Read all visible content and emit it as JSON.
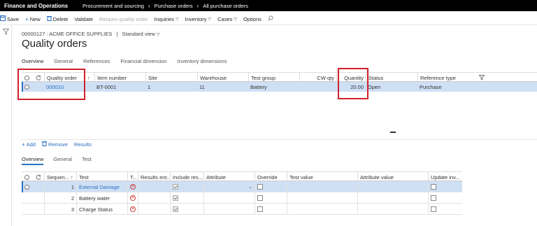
{
  "topbar": {
    "app_title": "Finance and Operations",
    "breadcrumbs": [
      "Procurement and sourcing",
      "Purchase orders",
      "All purchase orders"
    ]
  },
  "actionbar": {
    "save": "Save",
    "new": "New",
    "delete": "Delete",
    "validate": "Validate",
    "reopen": "Reopen quality order",
    "inquiries": "Inquiries",
    "inventory": "Inventory",
    "cases": "Cases",
    "options": "Options"
  },
  "header": {
    "record": "00000127 : ACME OFFICE SUPPLIES",
    "separator": "|",
    "view": "Standard view",
    "title": "Quality orders"
  },
  "tabs_top": [
    "Overview",
    "General",
    "References",
    "Financial dimension",
    "Inventory dimensions"
  ],
  "quality_grid": {
    "columns": {
      "quality_order": "Quality order",
      "item_number": "Item number",
      "site": "Site",
      "warehouse": "Warehouse",
      "test_group": "Test group",
      "cw_qty": "CW qty",
      "quantity": "Quantity",
      "status": "Status",
      "reference_type": "Reference type"
    },
    "rows": [
      {
        "quality_order": "000010",
        "item_number": "BT-0001",
        "site": "1",
        "warehouse": "11",
        "test_group": "Battery",
        "cw_qty": "",
        "quantity": "20.00",
        "status": "Open",
        "reference_type": "Purchase"
      }
    ]
  },
  "lines_actions": {
    "add": "Add",
    "remove": "Remove",
    "results": "Results"
  },
  "tabs_bottom": [
    "Overview",
    "General",
    "Test"
  ],
  "test_grid": {
    "columns": {
      "sequence": "Sequen...",
      "test": "Test",
      "t": "T...",
      "results_entered": "Results ent...",
      "include_results": "Include res...",
      "attribute": "Attribute",
      "override": "Override",
      "test_value": "Test value",
      "attribute_value": "Attribute value",
      "update_inventory": "Update inv..."
    },
    "rows": [
      {
        "sequence": "1",
        "test": "External Damage",
        "include": true
      },
      {
        "sequence": "2",
        "test": "Battery water",
        "include": true
      },
      {
        "sequence": "3",
        "test": "Charge Status",
        "include": true
      }
    ]
  },
  "colors": {
    "accent": "#2b6fc0",
    "selected_row": "#cfe0f5",
    "highlight": "#d0202c",
    "topbar": "#000000"
  }
}
